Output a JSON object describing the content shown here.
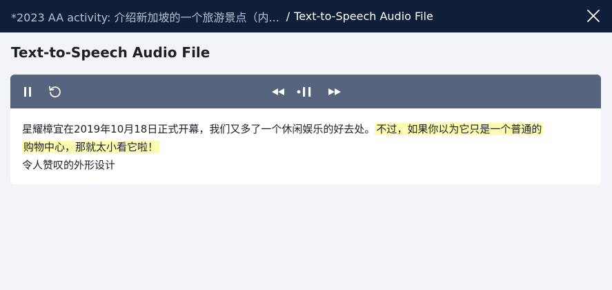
{
  "header": {
    "parent_title": "*2023 AA activity: 介绍新加坡的一个旅游景点（内...",
    "separator": "/",
    "current_title": "Text-to-Speech Audio File",
    "close_icon": "close-icon"
  },
  "page": {
    "title": "Text-to-Speech Audio File"
  },
  "player": {
    "controls": {
      "pause_icon": "pause-icon",
      "replay_icon": "replay-icon",
      "rewind_icon": "rewind-icon",
      "speed_icon": "playback-speed-icon",
      "forward_icon": "fast-forward-icon"
    },
    "colors": {
      "toolbar": "#56657d",
      "highlight": "#fdfbb0"
    },
    "transcript": {
      "line1_plain": "星耀樟宜在2019年10月18日正式开幕，我们又多了一个休闲娱乐的好去处。",
      "line1_highlight_a": "不过，如果你以为它只是一个普通的",
      "line1_highlight_b": "购物中心，那就太小看它啦！",
      "line2": "令人赞叹的外形设计"
    }
  }
}
